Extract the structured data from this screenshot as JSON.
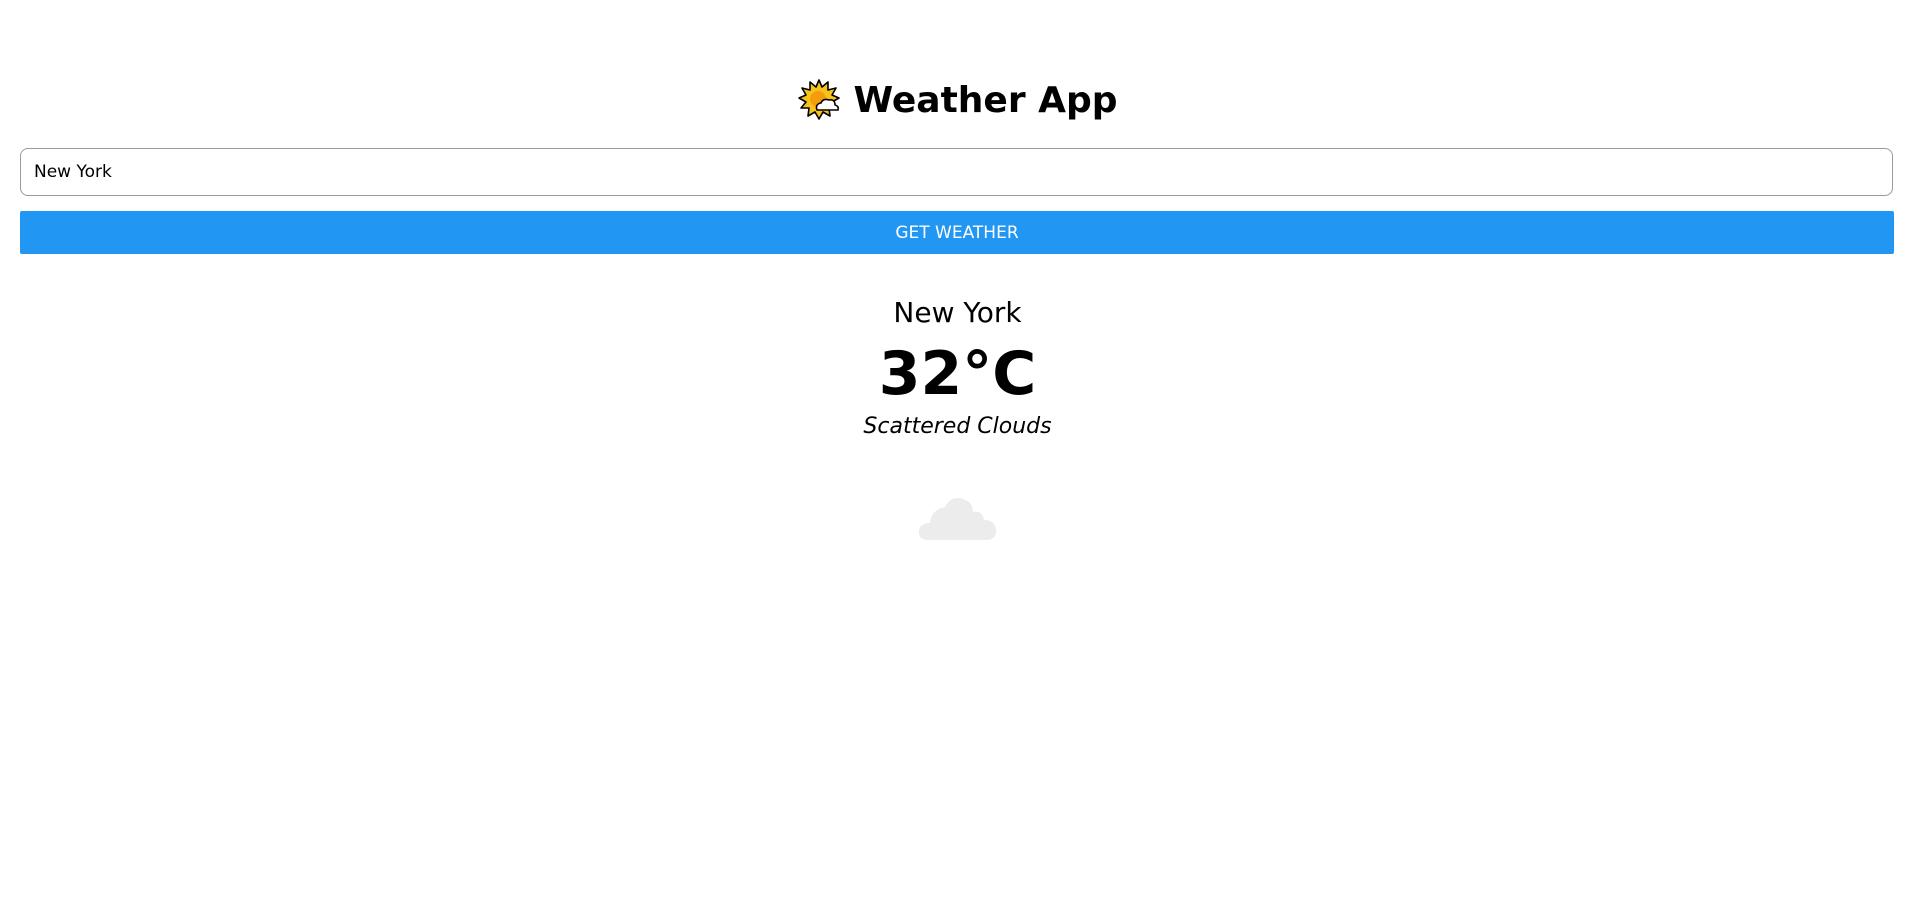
{
  "app": {
    "title": "Weather App",
    "title_icon": "sun-behind-cloud-icon"
  },
  "search": {
    "value": "New York",
    "button_label": "GET WEATHER"
  },
  "weather": {
    "city": "New York",
    "temperature": "32°C",
    "condition": "Scattered Clouds",
    "icon": "cloud-icon"
  },
  "colors": {
    "button_background": "#2196f3",
    "button_text": "#ffffff",
    "cloud": "#ececec"
  }
}
